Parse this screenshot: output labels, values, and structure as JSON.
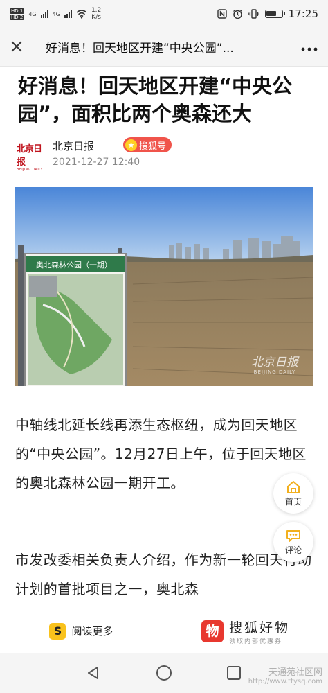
{
  "status_bar": {
    "sim1": "HD 1",
    "sim2": "HD 2",
    "signal1": "4G",
    "signal2": "4G",
    "net_speed_value": "1.2",
    "net_speed_unit": "K/s",
    "time": "17:25",
    "icons": [
      "nfc-icon",
      "alarm-icon",
      "vibrate-icon",
      "battery-icon"
    ]
  },
  "nav": {
    "close_icon": "close-icon",
    "title": "好消息！回天地区开建“中央公园”...",
    "more_icon": "more-icon"
  },
  "article": {
    "headline": "好消息！回天地区开建“中央公园”，面积比两个奥森还大",
    "source_logo_text": "北京日报",
    "source_logo_sub": "BEIJING DAILY",
    "source_name": "北京日报",
    "badge": "搜狐号",
    "date": "2021-12-27 12:40",
    "photo": {
      "sign_title": "奥北森林公园（一期）",
      "watermark": "北京日报",
      "watermark_sub": "BEIJING DAILY"
    },
    "paragraph1": "中轴线北延长线再添生态枢纽，成为回天地区的“中央公园”。12月27日上午，位于回天地区的奥北森林公园一期开工。",
    "paragraph2": "市发改委相关负责人介绍，作为新一轮回天行动计划的首批项目之一，奥北森"
  },
  "floating": {
    "home_label": "首页",
    "comment_label": "评论"
  },
  "bottom_bar": {
    "read_more_icon_text": "S",
    "read_more": "阅读更多",
    "brand_icon_text": "物",
    "brand_title": "搜狐好物",
    "brand_sub": "领取内部优惠券"
  },
  "system_nav": {
    "watermark1": "天通苑社区网",
    "watermark2": "http://www.ttysq.com"
  }
}
